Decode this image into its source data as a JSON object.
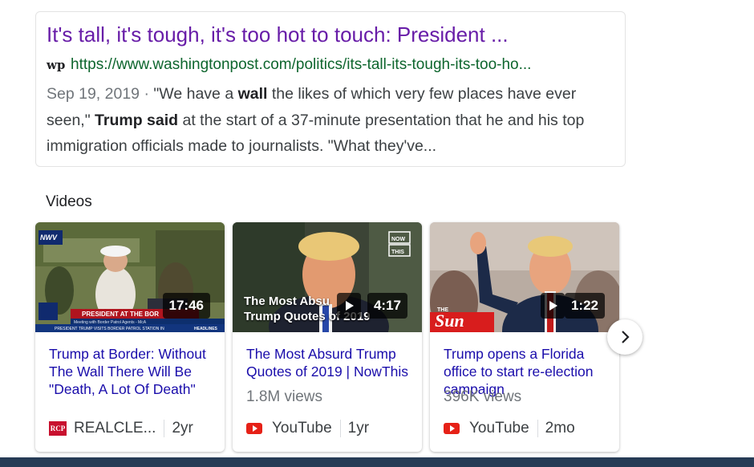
{
  "result": {
    "title": "It's tall, it's tough, it's too hot to touch: President ...",
    "favicon_text": "wp",
    "url": "https://www.washingtonpost.com/politics/its-tall-its-tough-its-too-ho...",
    "snippet": {
      "date": "Sep 19, 2019",
      "sep": " · ",
      "t1": "\"We have a ",
      "b1": "wall",
      "t2": " the likes of which very few places have ever seen,\" ",
      "b2": "Trump said",
      "t3": " at the start of a 37-minute presentation that he and his top immigration officials made to journalists. \"What they've..."
    }
  },
  "videos": {
    "section_title": "Videos",
    "items": [
      {
        "title": "Trump at Border: Without The Wall There Will Be \"Death, A Lot Of Death\"",
        "duration": "17:46",
        "views": "",
        "source": "REALCLE...",
        "source_icon": "rcp-icon",
        "source_icon_text": "RCP",
        "age": "2yr",
        "thumb_texts": {
          "logo": "NWV",
          "banner": "PRESIDENT AT THE BOR",
          "sub": "Meeting with Border Patrol Agents - McA",
          "ticker": "PRESIDENT TRUMP VISITS BORDER PATROL STATION IN",
          "headlines": "HEADLINES"
        }
      },
      {
        "title": "The Most Absurd Trump Quotes of 2019 | NowThis",
        "duration": "4:17",
        "views": "1.8M views",
        "source": "YouTube",
        "source_icon": "youtube-icon",
        "age": "1yr",
        "thumb_texts": {
          "overlay1": "The Most Absu",
          "overlay2": "Trump Quotes of 2019",
          "badge1": "NOW",
          "badge2": "THIS"
        }
      },
      {
        "title": "Trump opens a Florida office to start re-election campaign",
        "duration": "1:22",
        "views": "396K views",
        "source": "YouTube",
        "source_icon": "youtube-icon",
        "age": "2mo",
        "thumb_texts": {
          "logo_small": "THE",
          "logo": "Sun"
        }
      }
    ],
    "next_icon": "chevron-right-icon"
  },
  "colors": {
    "title": "#681da8",
    "url": "#0d652d",
    "video_title": "#1a0dab",
    "bottom_bar": "#263b55"
  }
}
